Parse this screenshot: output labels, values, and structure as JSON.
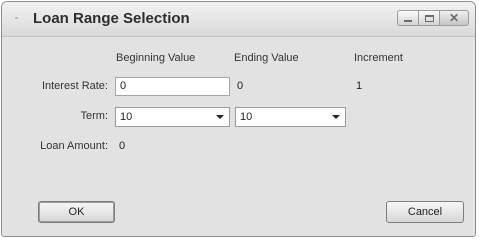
{
  "window": {
    "title": "Loan Range Selection",
    "icon": "grip-icon"
  },
  "title_buttons": {
    "minimize_icon": "minimize-icon",
    "maximize_icon": "maximize-icon",
    "close_symbol": "✕"
  },
  "columns": {
    "beginning": "Beginning Value",
    "ending": "Ending Value",
    "increment": "Increment"
  },
  "rows": {
    "interest_label": "Interest Rate:",
    "interest_begin": "0",
    "interest_end": "0",
    "interest_increment": "1",
    "term_label": "Term:",
    "term_begin": "10",
    "term_end": "10",
    "loan_label": "Loan Amount:",
    "loan_value": "0"
  },
  "buttons": {
    "ok": "OK",
    "cancel": "Cancel"
  }
}
